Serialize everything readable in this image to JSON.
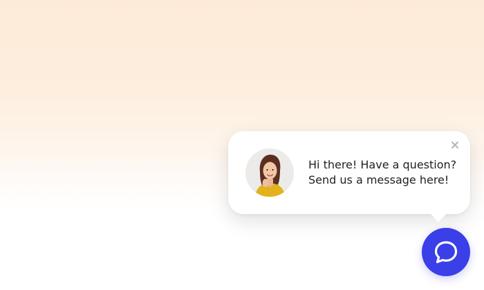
{
  "chat_widget": {
    "greeting": {
      "line1": "Hi there! Have a question?",
      "line2": "Send us a message here!"
    },
    "close_icon": "close-icon",
    "avatar_icon": "agent-avatar",
    "launcher_icon": "chat-bubble-icon"
  },
  "colors": {
    "accent": "#3a3fe8",
    "background_top": "#fdebd8",
    "bubble": "#ffffff",
    "text": "#1f1f24"
  }
}
